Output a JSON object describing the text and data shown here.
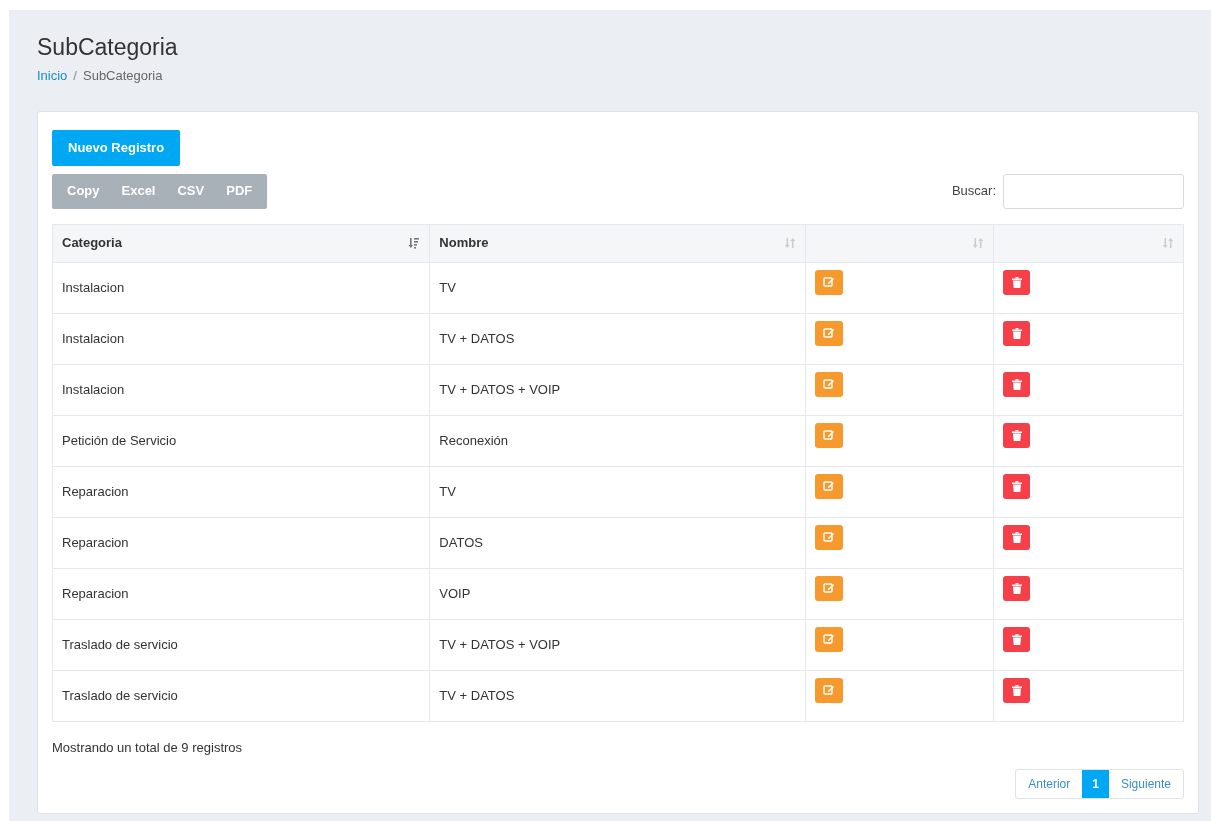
{
  "page": {
    "title": "SubCategoria"
  },
  "breadcrumb": {
    "separator": "/",
    "items": [
      {
        "label": "Inicio",
        "link": true
      },
      {
        "label": "SubCategoria",
        "link": false
      }
    ]
  },
  "new_button": "Nuevo Registro",
  "export_buttons": [
    "Copy",
    "Excel",
    "CSV",
    "PDF"
  ],
  "search": {
    "label": "Buscar:"
  },
  "table": {
    "columns": [
      {
        "label": "Categoria",
        "sorted": true
      },
      {
        "label": "Nombre",
        "sorted": false
      },
      {
        "sorted": false
      },
      {
        "sorted": false
      }
    ],
    "rows": [
      {
        "categoria": "Instalacion",
        "nombre": "TV"
      },
      {
        "categoria": "Instalacion",
        "nombre": "TV + DATOS"
      },
      {
        "categoria": "Instalacion",
        "nombre": "TV + DATOS + VOIP"
      },
      {
        "categoria": "Petición de Servicio",
        "nombre": "Reconexión"
      },
      {
        "categoria": "Reparacion",
        "nombre": "TV"
      },
      {
        "categoria": "Reparacion",
        "nombre": "DATOS"
      },
      {
        "categoria": "Reparacion",
        "nombre": "VOIP"
      },
      {
        "categoria": "Traslado de servicio",
        "nombre": "TV + DATOS + VOIP"
      },
      {
        "categoria": "Traslado de servicio",
        "nombre": "TV + DATOS"
      }
    ]
  },
  "info": "Mostrando un total de 9 registros",
  "pagination": {
    "previous": "Anterior",
    "pages": [
      {
        "label": "1",
        "selected": true
      }
    ],
    "next": "Siguiente"
  }
}
